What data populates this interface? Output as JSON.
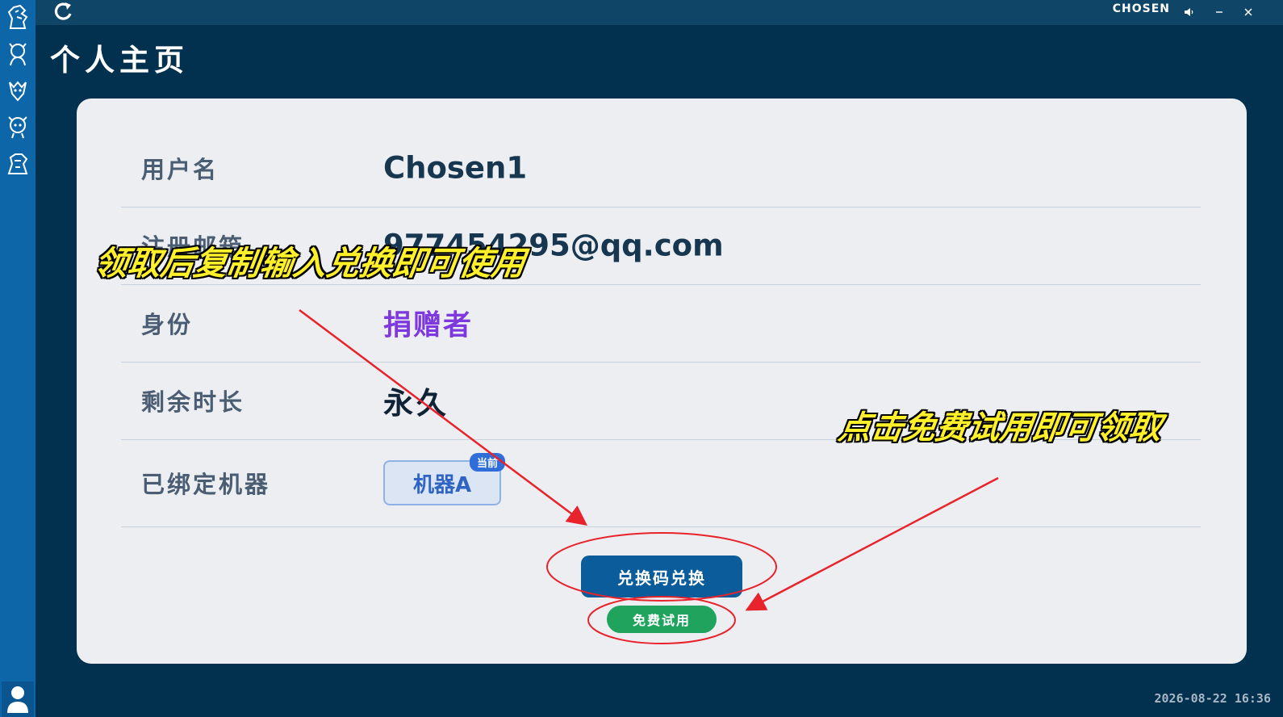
{
  "window": {
    "title": "CHOSEN"
  },
  "page": {
    "title": "个人主页"
  },
  "profile": {
    "username_label": "用户名",
    "username_value": "Chosen1",
    "email_label": "注册邮箱",
    "email_value": "977454295@qq.com",
    "role_label": "身份",
    "role_value": "捐赠者",
    "remaining_label": "剩余时长",
    "remaining_value": "永久",
    "machines_label": "已绑定机器",
    "machine_name": "机器A",
    "machine_badge": "当前"
  },
  "actions": {
    "redeem_label": "兑换码兑换",
    "trial_label": "免费试用"
  },
  "annotations": {
    "caption_left": "领取后复制输入兑换即可使用",
    "caption_right": "点击免费试用即可领取"
  },
  "footer": {
    "timestamp": "2026-08-22 16:36"
  },
  "colors": {
    "background": "#01314f",
    "sidebar": "#0c66a8",
    "card": "#eceef1",
    "role_purple": "#7d39dd",
    "redeem_button": "#0a5c9a",
    "trial_button": "#1fa35d",
    "annotation_red": "#e8232b",
    "caption_yellow": "#fff02a"
  },
  "icons": {
    "sidebar": [
      "character-icon-1",
      "character-icon-2",
      "character-icon-3",
      "character-icon-4",
      "character-icon-5"
    ],
    "avatar": "user-icon",
    "app_logo": "refresh-logo-icon"
  }
}
